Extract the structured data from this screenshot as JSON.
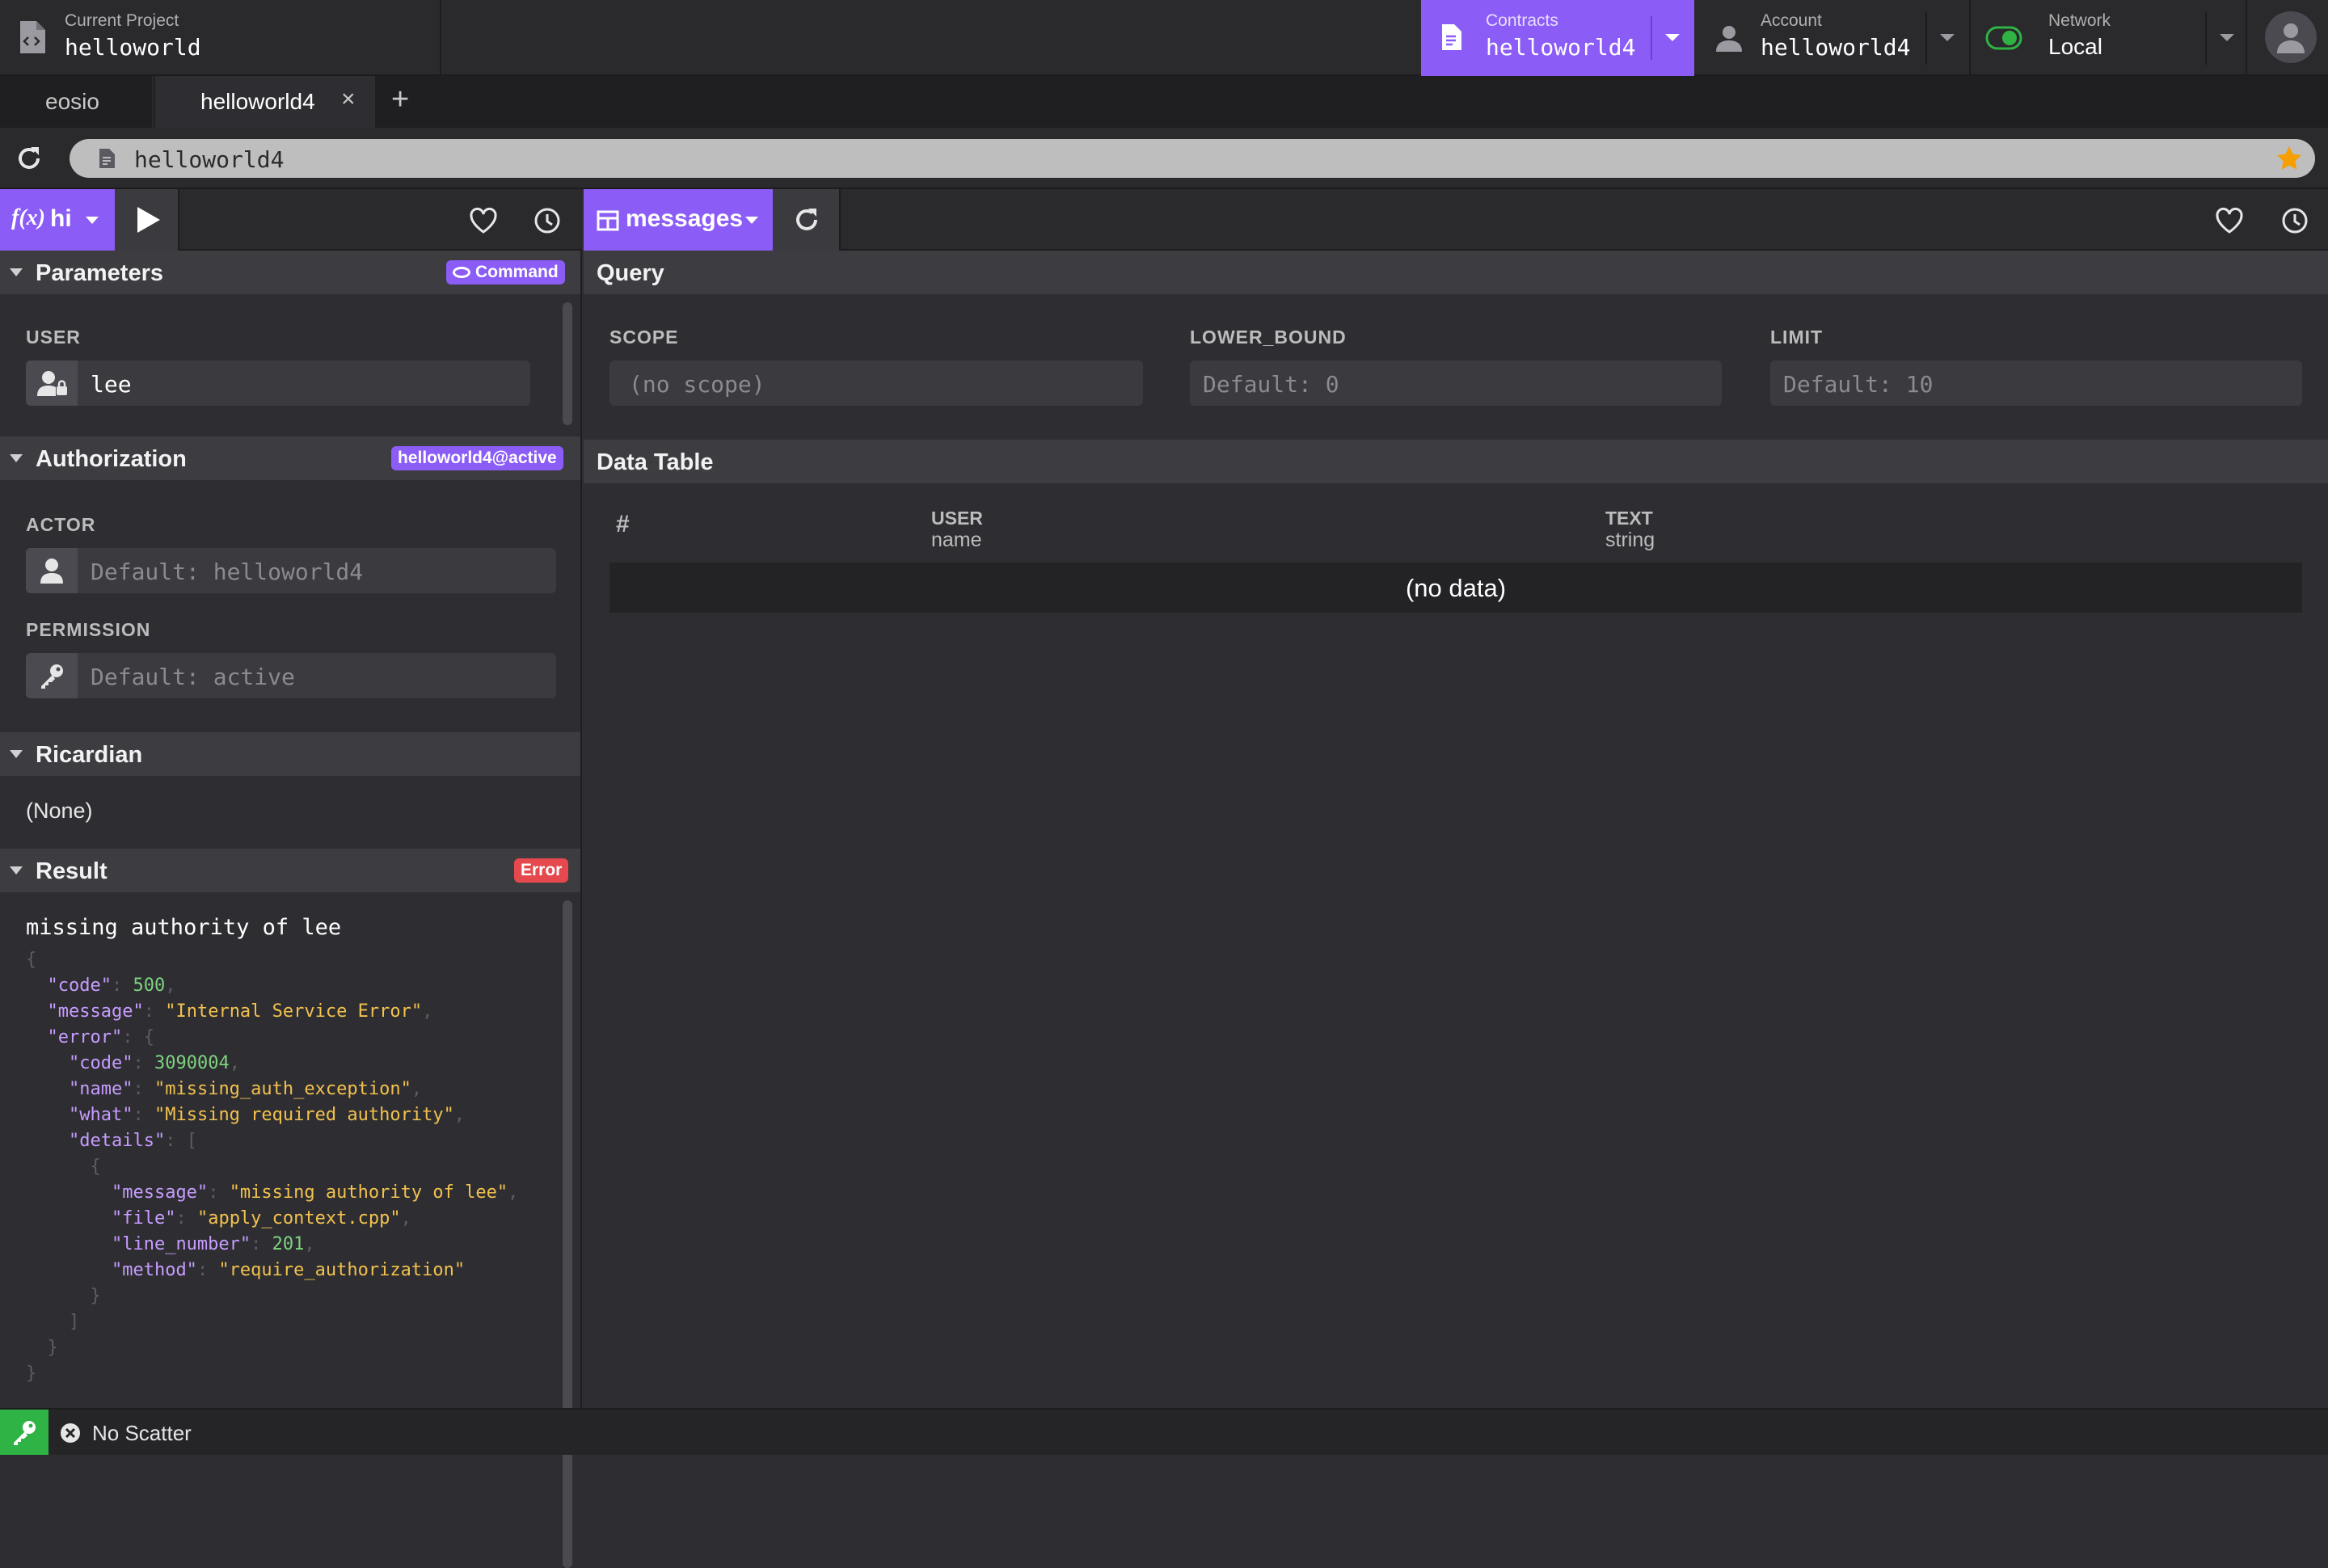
{
  "topbar": {
    "project_label": "Current Project",
    "project_value": "helloworld",
    "contracts_label": "Contracts",
    "contracts_value": "helloworld4",
    "account_label": "Account",
    "account_value": "helloworld4",
    "network_label": "Network",
    "network_value": "Local"
  },
  "tabs": [
    {
      "label": "eosio"
    },
    {
      "label": "helloworld4",
      "close": "×"
    }
  ],
  "tab_add": "+",
  "address": {
    "value": "helloworld4"
  },
  "action_panel": {
    "function_label": "hi",
    "parameters": {
      "title": "Parameters",
      "badge": "Command",
      "user_label": "USER",
      "user_value": "lee"
    },
    "authorization": {
      "title": "Authorization",
      "badge": "helloworld4@active",
      "actor_label": "ACTOR",
      "actor_placeholder": "Default: helloworld4",
      "permission_label": "PERMISSION",
      "permission_placeholder": "Default: active"
    },
    "ricardian": {
      "title": "Ricardian",
      "value": "(None)"
    },
    "result": {
      "title": "Result",
      "badge": "Error",
      "message": "missing authority of lee",
      "json": {
        "code_key": "\"code\"",
        "code_val": "500",
        "message_key": "\"message\"",
        "message_val": "\"Internal Service Error\"",
        "error_key": "\"error\"",
        "e_code_key": "\"code\"",
        "e_code_val": "3090004",
        "e_name_key": "\"name\"",
        "e_name_val": "\"missing_auth_exception\"",
        "e_what_key": "\"what\"",
        "e_what_val": "\"Missing required authority\"",
        "e_details_key": "\"details\"",
        "d_message_key": "\"message\"",
        "d_message_val": "\"missing authority of lee\"",
        "d_file_key": "\"file\"",
        "d_file_val": "\"apply_context.cpp\"",
        "d_line_key": "\"line_number\"",
        "d_line_val": "201",
        "d_method_key": "\"method\"",
        "d_method_val": "\"require_authorization\""
      }
    }
  },
  "table_panel": {
    "table_label": "messages",
    "query": {
      "title": "Query",
      "scope_label": "SCOPE",
      "scope_placeholder": "(no scope)",
      "lower_label": "LOWER_BOUND",
      "lower_placeholder": "Default: 0",
      "limit_label": "LIMIT",
      "limit_placeholder": "Default: 10"
    },
    "data_table": {
      "title": "Data Table",
      "columns": [
        {
          "name": "#",
          "type": ""
        },
        {
          "name": "USER",
          "type": "name"
        },
        {
          "name": "TEXT",
          "type": "string"
        }
      ],
      "empty": "(no data)"
    }
  },
  "status": {
    "scatter": "No Scatter"
  },
  "colors": {
    "accent": "#8b5cf6",
    "error": "#e5484d",
    "toggle": "#2fb344",
    "star": "#f59f00"
  }
}
